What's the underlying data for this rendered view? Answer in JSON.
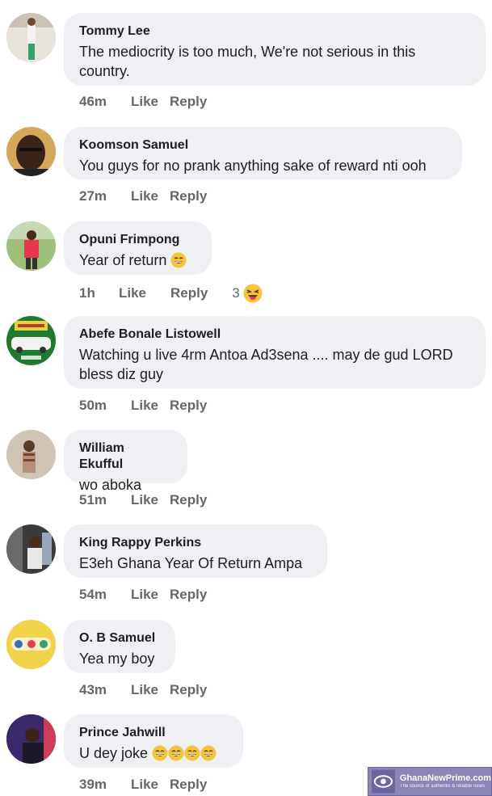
{
  "actions": {
    "like": "Like",
    "reply": "Reply"
  },
  "comments": [
    {
      "author": "Tommy Lee",
      "text": "The mediocrity is too much, We're  not serious  in this country.",
      "time": "46m"
    },
    {
      "author": "Koomson Samuel",
      "text": "You guys for no prank anything sake of reward nti ooh",
      "time": "27m"
    },
    {
      "author": "Opuni Frimpong",
      "text": "Year of return",
      "time": "1h",
      "reaction_count": "3"
    },
    {
      "author": "Abefe Bonale Listowell",
      "text": "Watching u live 4rm Antoa Ad3sena  .... may de gud LORD bless diz guy",
      "time": "50m"
    },
    {
      "author": "William Ekufful",
      "text": "wo aboka",
      "time": "51m"
    },
    {
      "author": "King Rappy Perkins",
      "text": "E3eh Ghana Year Of Return Ampa",
      "time": "54m"
    },
    {
      "author": "O. B Samuel",
      "text": "Yea my boy",
      "time": "43m"
    },
    {
      "author": "Prince Jahwill",
      "text": "U dey joke",
      "time": "39m"
    }
  ],
  "watermark": {
    "title": "GhanaNewPrime.com",
    "subtitle": "The source of authentic & reliable news"
  },
  "colors": {
    "bubble": "#eef0f3",
    "meta": "#65676b",
    "text": "#1c1e21"
  }
}
